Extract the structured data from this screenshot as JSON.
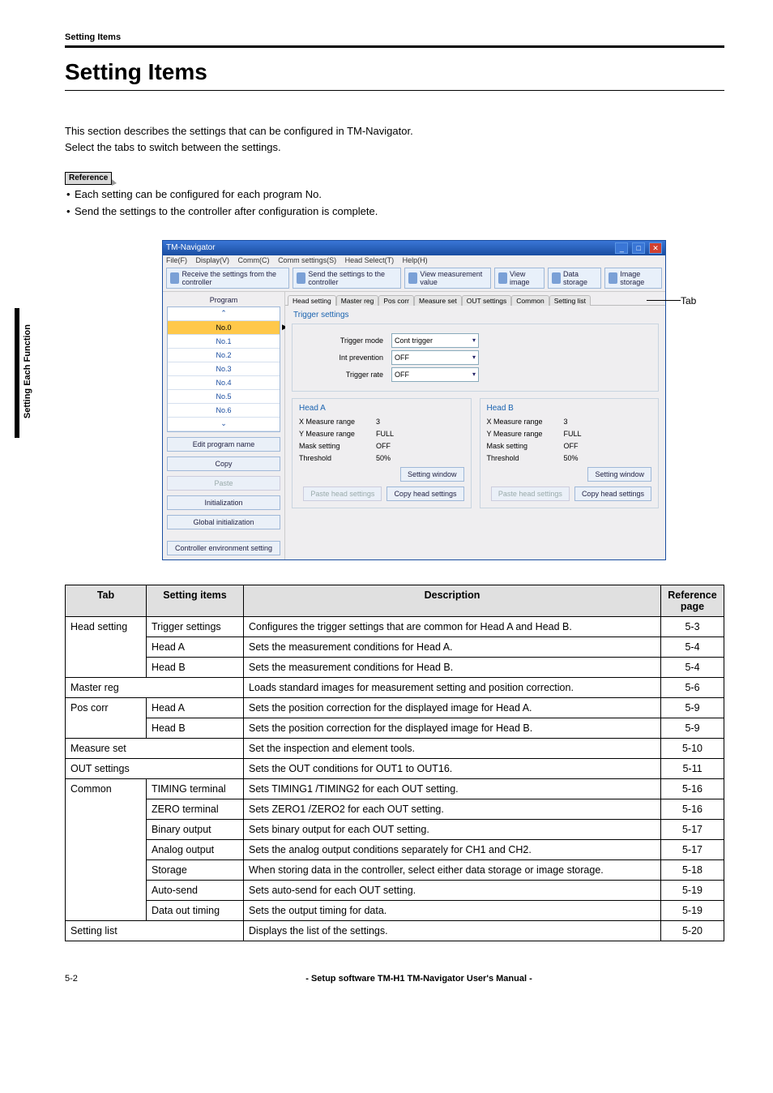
{
  "running_header": "Setting Items",
  "h1": "Setting Items",
  "intro_line1": "This section describes the settings that can be configured in TM-Navigator.",
  "intro_line2": "Select the tabs to switch between the settings.",
  "reference_label": "Reference",
  "bullet1": "Each setting can be configured for each program No.",
  "bullet2": "Send the settings to the controller after configuration is complete.",
  "side_tab": "Setting Each Function",
  "tab_callout": "Tab",
  "shot": {
    "title": "TM-Navigator",
    "menu": {
      "m1": "File(F)",
      "m2": "Display(V)",
      "m3": "Comm(C)",
      "m4": "Comm settings(S)",
      "m5": "Head Select(T)",
      "m6": "Help(H)"
    },
    "tbtns": {
      "t1": "Receive the settings from the controller",
      "t2": "Send the settings to the controller",
      "t3": "View measurement value",
      "t4": "View image",
      "t5": "Data storage",
      "t6": "Image storage"
    },
    "sidebar": {
      "program": "Program",
      "rows": {
        "r0": "No.0",
        "r1": "No.1",
        "r2": "No.2",
        "r3": "No.3",
        "r4": "No.4",
        "r5": "No.5",
        "r6": "No.6"
      },
      "arrow_up": "✕",
      "arrow_dn": "✕",
      "btns": {
        "b1": "Edit program name",
        "b2": "Copy",
        "b3": "Paste",
        "b4": "Initialization",
        "b5": "Global initialization",
        "b6": "Controller environment setting"
      },
      "sel_indicator": "▶"
    },
    "tabs": {
      "t1": "Head setting",
      "t2": "Master reg",
      "t3": "Pos corr",
      "t4": "Measure set",
      "t5": "OUT settings",
      "t6": "Common",
      "t7": "Setting list"
    },
    "groups": {
      "trigger": "Trigger settings",
      "headA": "Head A",
      "headB": "Head B"
    },
    "fields": {
      "trigger_mode_l": "Trigger mode",
      "trigger_mode_v": "Cont trigger",
      "int_prev_l": "Int prevention",
      "int_prev_v": "OFF",
      "trigger_rate_l": "Trigger rate",
      "trigger_rate_v": "OFF",
      "x_range_l": "X Measure range",
      "x_range_a": "3",
      "x_range_b": "3",
      "y_range_l": "Y Measure range",
      "y_range_a": "FULL",
      "y_range_b": "FULL",
      "mask_l": "Mask setting",
      "mask_a": "OFF",
      "mask_b": "OFF",
      "thresh_l": "Threshold",
      "thresh_a": "50%",
      "thresh_b": "50%",
      "setwin": "Setting window",
      "paste_hs": "Paste head settings",
      "copy_hs": "Copy head settings"
    }
  },
  "table": {
    "header": {
      "c1": "Tab",
      "c2": "Setting items",
      "c3": "Description",
      "c4": "Reference page"
    },
    "rows": [
      {
        "tab": "Head setting",
        "item": "Trigger settings",
        "desc": "Configures the trigger settings that are common for Head A and Head B.",
        "ref": "5-3",
        "tab_rows": 3
      },
      {
        "tab": "",
        "item": "Head A",
        "desc": "Sets the measurement conditions for Head A.",
        "ref": "5-4"
      },
      {
        "tab": "",
        "item": "Head B",
        "desc": "Sets the measurement conditions for Head B.",
        "ref": "5-4"
      },
      {
        "tab": "Master reg",
        "span": true,
        "desc": "Loads standard images for measurement setting and position correction.",
        "ref": "5-6"
      },
      {
        "tab": "Pos corr",
        "item": "Head A",
        "desc": "Sets the position correction for the displayed image for Head A.",
        "ref": "5-9",
        "tab_rows": 2
      },
      {
        "tab": "",
        "item": "Head B",
        "desc": "Sets the position correction for the displayed image for Head B.",
        "ref": "5-9"
      },
      {
        "tab": "Measure set",
        "span": true,
        "desc": "Set the inspection and element tools.",
        "ref": "5-10"
      },
      {
        "tab": "OUT settings",
        "span": true,
        "desc": "Sets the OUT conditions for OUT1 to OUT16.",
        "ref": "5-11"
      },
      {
        "tab": "Common",
        "item": "TIMING terminal",
        "desc": "Sets TIMING1 /TIMING2 for each OUT setting.",
        "ref": "5-16",
        "tab_rows": 7
      },
      {
        "tab": "",
        "item": "ZERO terminal",
        "desc": "Sets ZERO1 /ZERO2 for each OUT setting.",
        "ref": "5-16"
      },
      {
        "tab": "",
        "item": "Binary output",
        "desc": "Sets binary output for each OUT setting.",
        "ref": "5-17"
      },
      {
        "tab": "",
        "item": "Analog output",
        "desc": "Sets the analog output conditions separately for CH1 and CH2.",
        "ref": "5-17"
      },
      {
        "tab": "",
        "item": "Storage",
        "desc": "When storing data in the controller, select either data storage or image storage.",
        "ref": "5-18"
      },
      {
        "tab": "",
        "item": "Auto-send",
        "desc": "Sets auto-send for each OUT setting.",
        "ref": "5-19"
      },
      {
        "tab": "",
        "item": "Data out timing",
        "desc": "Sets the output timing for data.",
        "ref": "5-19"
      },
      {
        "tab": "Setting list",
        "span": true,
        "desc": "Displays the list of the settings.",
        "ref": "5-20"
      }
    ]
  },
  "footer": {
    "page": "5-2",
    "title": "- Setup software TM-H1 TM-Navigator User's Manual -"
  }
}
